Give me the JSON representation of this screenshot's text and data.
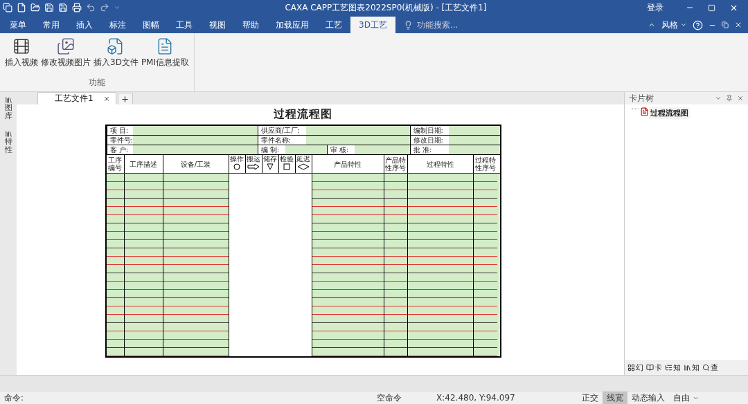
{
  "window": {
    "title": "CAXA CAPP工艺图表2022SP0(机械版) - [工艺文件1]",
    "login": "登录"
  },
  "menu_tabs": [
    {
      "label": "菜单",
      "selected": false
    },
    {
      "label": "常用",
      "selected": false
    },
    {
      "label": "插入",
      "selected": false
    },
    {
      "label": "标注",
      "selected": false
    },
    {
      "label": "图幅",
      "selected": false
    },
    {
      "label": "工具",
      "selected": false
    },
    {
      "label": "视图",
      "selected": false
    },
    {
      "label": "帮助",
      "selected": false
    },
    {
      "label": "加载应用",
      "selected": false
    },
    {
      "label": "工艺",
      "selected": false
    },
    {
      "label": "3D工艺",
      "selected": true
    }
  ],
  "feature_search": {
    "placeholder": "功能搜索..."
  },
  "style_menu": "风格",
  "ribbon": {
    "group": "功能",
    "buttons": [
      {
        "label": "插入视频",
        "kind": "video"
      },
      {
        "label": "修改视频图片",
        "kind": "picture"
      },
      {
        "label": "插入3D文件",
        "kind": "model"
      },
      {
        "label": "PMI信息提取",
        "kind": "pmi"
      }
    ]
  },
  "side_strip": [
    "图库",
    "特性"
  ],
  "doc_tabs": [
    {
      "label": "工艺文件1",
      "selected": true
    }
  ],
  "sheet": {
    "title": "过程流程图",
    "info_rows": [
      [
        "项 目:",
        "供应商/工厂:",
        "编制日期:"
      ],
      [
        "零件号:",
        "零件名称:",
        "修改日期:"
      ],
      [
        "客 户:",
        "编 制:",
        "审 核:",
        "批 准:"
      ]
    ],
    "columns": [
      {
        "label": "工序编号",
        "kind": "text"
      },
      {
        "label": "工序描述",
        "kind": "text"
      },
      {
        "label": "设备/工装",
        "kind": "text"
      },
      {
        "label": "操作",
        "kind": "circle"
      },
      {
        "label": "搬运",
        "kind": "arrow"
      },
      {
        "label": "储存",
        "kind": "triangle"
      },
      {
        "label": "检验",
        "kind": "square"
      },
      {
        "label": "延迟",
        "kind": "diamond"
      },
      {
        "label": "产品特性",
        "kind": "text"
      },
      {
        "label": "产品特性序号",
        "kind": "text"
      },
      {
        "label": "过程特性",
        "kind": "text"
      },
      {
        "label": "过程特性序号",
        "kind": "text"
      }
    ]
  },
  "card_tree": {
    "title": "卡片树",
    "items": [
      {
        "label": "过程流程图",
        "selected": false
      }
    ],
    "tabs": [
      "幻",
      "卡",
      "知",
      "知",
      "查"
    ]
  },
  "status_bar": {
    "command_label": "命令:",
    "state": "空命令",
    "coords": "X:42.480, Y:94.097",
    "toggles": [
      {
        "label": "正交",
        "selected": false
      },
      {
        "label": "线宽",
        "selected": true
      },
      {
        "label": "动态输入",
        "selected": false
      },
      {
        "label": "自由",
        "selected": false
      }
    ]
  }
}
